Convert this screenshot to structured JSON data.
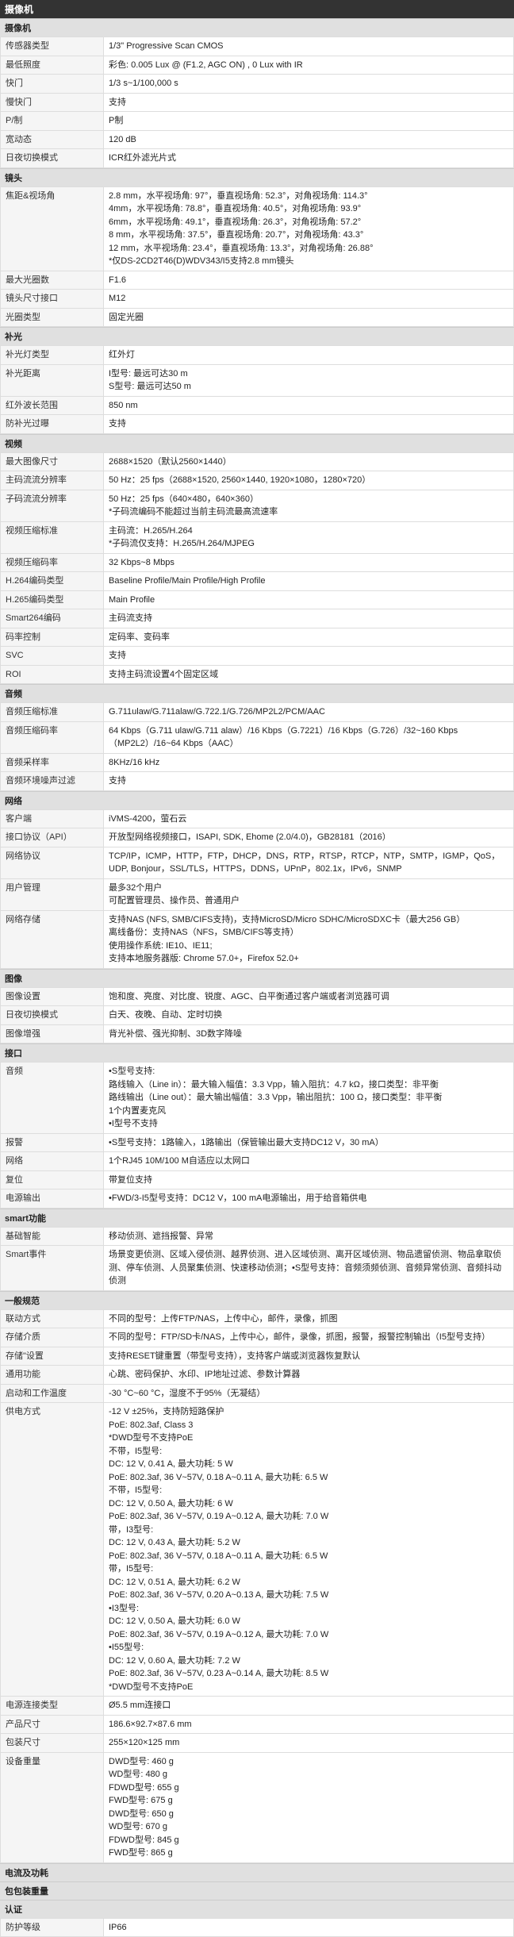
{
  "title": "摄像机",
  "sections": [
    {
      "header": "摄像机",
      "rows": [
        {
          "label": "传感器类型",
          "value": "1/3\" Progressive Scan CMOS"
        },
        {
          "label": "最低照度",
          "value": "彩色: 0.005 Lux @ (F1.2, AGC ON) , 0 Lux with IR"
        },
        {
          "label": "快门",
          "value": "1/3 s~1/100,000 s"
        },
        {
          "label": "慢快门",
          "value": "支持"
        },
        {
          "label": "P/制",
          "value": "P制"
        },
        {
          "label": "宽动态",
          "value": "120 dB"
        },
        {
          "label": "日夜切换模式",
          "value": "ICR红外滤光片式"
        }
      ]
    },
    {
      "header": "镜头",
      "rows": [
        {
          "label": "焦距&视场角",
          "value": "2.8 mm，水平视场角: 97°，垂直视场角: 52.3°，对角视场角: 114.3°\n4mm，水平视场角: 78.8°，垂直视场角: 40.5°，对角视场角: 93.9°\n6mm，水平视场角: 49.1°，垂直视场角: 26.3°，对角视场角: 57.2°\n8 mm，水平视场角: 37.5°，垂直视场角: 20.7°，对角视场角: 43.3°\n12 mm，水平视场角: 23.4°，垂直视场角: 13.3°，对角视场角: 26.88°\n*仅DS-2CD2T46(D)WDV343/I5支持2.8 mm镜头"
        },
        {
          "label": "最大光圈数",
          "value": "F1.6"
        },
        {
          "label": "镜头尺寸接口",
          "value": "M12"
        },
        {
          "label": "光圈类型",
          "value": "固定光圈"
        }
      ]
    },
    {
      "header": "补光",
      "rows": [
        {
          "label": "补光灯类型",
          "value": "红外灯"
        },
        {
          "label": "补光距离",
          "value": "I型号: 最远可达30 m\nS型号: 最远可达50 m"
        },
        {
          "label": "红外波长范围",
          "value": "850 nm"
        },
        {
          "label": "防补光过曝",
          "value": "支持"
        }
      ]
    },
    {
      "header": "视频",
      "rows": [
        {
          "label": "最大图像尺寸",
          "value": "2688×1520（默认2560×1440）"
        },
        {
          "label": "主码流流分辨率",
          "value": "50 Hz：25 fps（2688×1520, 2560×1440, 1920×1080，1280×720）"
        },
        {
          "label": "子码流流分辨率",
          "value": "50 Hz：25 fps（640×480，640×360）\n*子码流编码不能超过当前主码流最高流速率"
        },
        {
          "label": "视频压缩标准",
          "value": "主码流：H.265/H.264\n*子码流仅支持：H.265/H.264/MJPEG"
        },
        {
          "label": "视频压缩码率",
          "value": "32 Kbps~8 Mbps"
        },
        {
          "label": "H.264编码类型",
          "value": "Baseline Profile/Main Profile/High Profile"
        },
        {
          "label": "H.265编码类型",
          "value": "Main Profile"
        },
        {
          "label": "Smart264编码",
          "value": "主码流支持"
        },
        {
          "label": "码率控制",
          "value": "定码率、变码率"
        },
        {
          "label": "SVC",
          "value": "支持"
        },
        {
          "label": "ROI",
          "value": "支持主码流设置4个固定区域"
        }
      ]
    },
    {
      "header": "音频",
      "rows": [
        {
          "label": "音频压缩标准",
          "value": "G.711ulaw/G.711alaw/G.722.1/G.726/MP2L2/PCM/AAC"
        },
        {
          "label": "音频压缩码率",
          "value": "64 Kbps（G.711 ulaw/G.711 alaw）/16 Kbps（G.7221）/16 Kbps（G.726）/32~160 Kbps（MP2L2）/16~64 Kbps（AAC）"
        },
        {
          "label": "音频采样率",
          "value": "8KHz/16 kHz"
        },
        {
          "label": "音频环境噪声过滤",
          "value": "支持"
        }
      ]
    },
    {
      "header": "网络",
      "rows": [
        {
          "label": "客户端",
          "value": "iVMS-4200，萤石云"
        },
        {
          "label": "接口协议（API）",
          "value": "开放型网络视频接口，ISAPI, SDK, Ehome (2.0/4.0)，GB28181（2016）"
        },
        {
          "label": "网络协议",
          "value": "TCP/IP，ICMP，HTTP，FTP，DHCP，DNS，RTP，RTSP，RTCP，NTP，SMTP，IGMP，QoS，UDP, Bonjour，SSL/TLS，HTTPS，DDNS，UPnP，802.1x，IPv6，SNMP"
        },
        {
          "label": "用户管理",
          "value": "最多32个用户\n可配置管理员、操作员、普通用户"
        },
        {
          "label": "网络存储",
          "value": "支持NAS (NFS, SMB/CIFS支持)，支持MicroSD/Micro SDHC/MicroSDXC卡（最大256 GB）\n离线备份：支持NAS（NFS，SMB/CIFS等支持）\n使用操作系统: IE10、IE11;\n支持本地服务器版: Chrome 57.0+，Firefox 52.0+"
        }
      ]
    },
    {
      "header": "图像",
      "rows": [
        {
          "label": "图像设置",
          "value": "饱和度、亮度、对比度、锐度、AGC、白平衡通过客户端或者浏览器可调"
        },
        {
          "label": "日夜切换模式",
          "value": "白天、夜晚、自动、定时切换"
        },
        {
          "label": "图像增强",
          "value": "背光补偿、强光抑制、3D数字降噪"
        }
      ]
    },
    {
      "header": "接口",
      "rows": [
        {
          "label": "音频",
          "value": "•S型号支持:\n路线输入（Line in）：最大输入幅值：3.3 Vpp，输入阻抗：4.7 kΩ，接口类型：非平衡\n路线输出（Line out）：最大输出幅值：3.3 Vpp，输出阻抗：100 Ω，接口类型：非平衡\n1个内置麦克风\n•I型号不支持"
        },
        {
          "label": "报警",
          "value": "•S型号支持：1路输入，1路输出（保管输出最大支持DC12 V，30 mA）"
        },
        {
          "label": "网络",
          "value": "1个RJ45 10M/100 M自适应以太网口"
        },
        {
          "label": "复位",
          "value": "带复位支持"
        },
        {
          "label": "电源输出",
          "value": "•FWD/3-I5型号支持：DC12 V，100 mA电源输出，用于给音箱供电"
        }
      ]
    },
    {
      "header": "smart功能",
      "rows": [
        {
          "label": "基础智能",
          "value": "移动侦测、遮挡报警、异常"
        },
        {
          "label": "Smart事件",
          "value": "场景变更侦测、区域入侵侦测、越界侦测、进入区域侦测、离开区域侦测、物品遗留侦测、物品拿取侦测、停车侦测、人员聚集侦测、快速移动侦测；•S型号支持：音频须频侦测、音频异常侦测、音频抖动侦测"
        }
      ]
    },
    {
      "header": "一般规范",
      "rows": [
        {
          "label": "联动方式",
          "value": "不同的型号：上传FTP/NAS，上传中心，邮件，录像，抓图"
        },
        {
          "label": "存储介质",
          "value": "不同的型号：FTP/SD卡/NAS，上传中心，邮件，录像，抓图，报警，报警控制输出（I5型号支持）"
        },
        {
          "label": "存储\"设置",
          "value": "支持RESET键重置（带型号支持），支持客户端或浏览器恢复默认"
        },
        {
          "label": "通用功能",
          "value": "心跳、密码保护、水印、IP地址过滤、参数计算器"
        },
        {
          "label": "启动和工作温度",
          "value": "-30 °C~60 °C，湿度不于95%（无凝结）"
        },
        {
          "label": "供电方式",
          "value": "-12 V ±25%，支持防短路保护\nPoE: 802.3af, Class 3\n*DWD型号不支持PoE\n不带，I5型号:\nDC: 12 V, 0.41 A, 最大功耗: 5 W\nPoE: 802.3af, 36 V~57V, 0.18 A~0.11 A, 最大功耗: 6.5 W\n不带，I5型号:\nDC: 12 V, 0.50 A, 最大功耗: 6 W\nPoE: 802.3af, 36 V~57V, 0.19 A~0.12 A, 最大功耗: 7.0 W\n带，I3型号:\nDC: 12 V, 0.43 A, 最大功耗: 5.2 W\nPoE: 802.3af, 36 V~57V, 0.18 A~0.11 A, 最大功耗: 6.5 W\n带，I5型号:\nDC: 12 V, 0.51 A, 最大功耗: 6.2 W\nPoE: 802.3af, 36 V~57V, 0.20 A~0.13 A, 最大功耗: 7.5 W\n•I3型号:\nDC: 12 V, 0.50 A, 最大功耗: 6.0 W\nPoE: 802.3af, 36 V~57V, 0.19 A~0.12 A, 最大功耗: 7.0 W\n•I55型号:\nDC: 12 V, 0.60 A, 最大功耗: 7.2 W\nPoE: 802.3af, 36 V~57V, 0.23 A~0.14 A, 最大功耗: 8.5 W\n*DWD型号不支持PoE"
        },
        {
          "label": "电源连接类型",
          "value": "Ø5.5 mm连接口"
        },
        {
          "label": "产品尺寸",
          "value": "186.6×92.7×87.6 mm"
        },
        {
          "label": "包装尺寸",
          "value": "255×120×125 mm"
        },
        {
          "label": "设备重量",
          "value": "DWD型号: 460 g\nWD型号: 480 g\nFDWD型号: 655 g\nFWD型号: 675 g\nDWD型号: 650 g\nWD型号: 670 g\nFDWD型号: 845 g\nFWD型号: 865 g"
        }
      ]
    },
    {
      "header": "电流及功耗",
      "rows": []
    },
    {
      "header": "包包装重量",
      "rows": []
    },
    {
      "header": "认证",
      "rows": [
        {
          "label": "防护等级",
          "value": "IP66"
        }
      ]
    }
  ]
}
